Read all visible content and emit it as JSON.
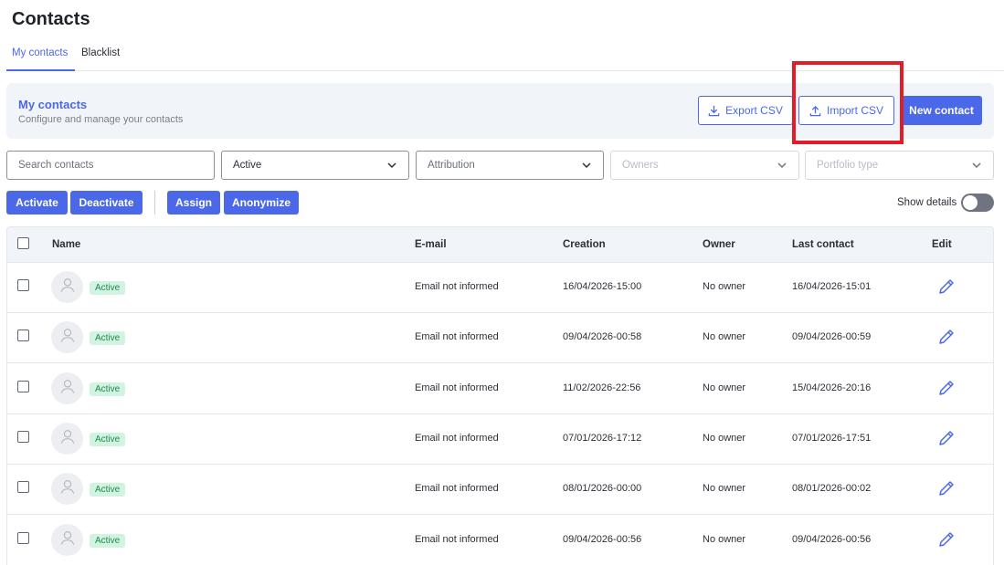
{
  "page": {
    "title": "Contacts"
  },
  "tabs": [
    {
      "label": "My contacts",
      "active": true
    },
    {
      "label": "Blacklist",
      "active": false
    }
  ],
  "header": {
    "title": "My contacts",
    "subtitle": "Configure and manage your contacts",
    "export_label": "Export CSV",
    "import_label": "Import CSV",
    "new_label": "New contact"
  },
  "filters": {
    "search_placeholder": "Search contacts",
    "status_value": "Active",
    "attribution_placeholder": "Attribution",
    "owners_placeholder": "Owners",
    "portfolio_placeholder": "Portfolio type"
  },
  "actions": {
    "activate": "Activate",
    "deactivate": "Deactivate",
    "assign": "Assign",
    "anonymize": "Anonymize",
    "show_details": "Show details",
    "show_details_on": false
  },
  "table": {
    "columns": {
      "name": "Name",
      "email": "E-mail",
      "creation": "Creation",
      "owner": "Owner",
      "last_contact": "Last contact",
      "edit": "Edit"
    },
    "rows": [
      {
        "status": "Active",
        "email": "Email not informed",
        "creation": "16/04/2026-15:00",
        "owner": "No owner",
        "last_contact": "16/04/2026-15:01"
      },
      {
        "status": "Active",
        "email": "Email not informed",
        "creation": "09/04/2026-00:58",
        "owner": "No owner",
        "last_contact": "09/04/2026-00:59"
      },
      {
        "status": "Active",
        "email": "Email not informed",
        "creation": "11/02/2026-22:56",
        "owner": "No owner",
        "last_contact": "15/04/2026-20:16"
      },
      {
        "status": "Active",
        "email": "Email not informed",
        "creation": "07/01/2026-17:12",
        "owner": "No owner",
        "last_contact": "07/01/2026-17:51"
      },
      {
        "status": "Active",
        "email": "Email not informed",
        "creation": "08/01/2026-00:00",
        "owner": "No owner",
        "last_contact": "08/01/2026-00:02"
      },
      {
        "status": "Active",
        "email": "Email not informed",
        "creation": "09/04/2026-00:56",
        "owner": "No owner",
        "last_contact": "09/04/2026-00:56"
      }
    ]
  },
  "colors": {
    "accent": "#4a68e8",
    "highlight": "#e11d2a",
    "badge_bg": "#d3f3e2",
    "badge_text": "#1f8a4c"
  }
}
